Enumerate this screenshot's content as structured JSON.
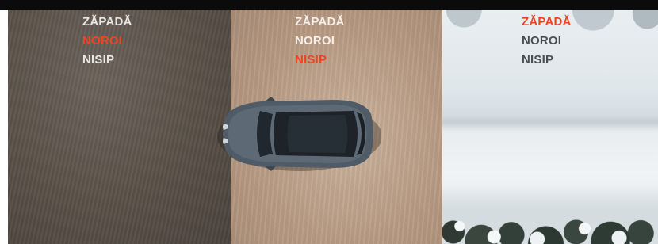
{
  "panels": [
    {
      "terrain": "mud",
      "labels": [
        "ZĂPADĂ",
        "NOROI",
        "NISIP"
      ],
      "active_index": 1
    },
    {
      "terrain": "sand",
      "labels": [
        "ZĂPADĂ",
        "NOROI",
        "NISIP"
      ],
      "active_index": 2
    },
    {
      "terrain": "snow",
      "labels": [
        "ZĂPADĂ",
        "NOROI",
        "NISIP"
      ],
      "active_index": 0
    }
  ],
  "colors": {
    "active": "#ef4423",
    "inactive_light": "#e9e6e2",
    "inactive_dark": "#4a4f53",
    "top_bar": "#0b0b0b"
  }
}
